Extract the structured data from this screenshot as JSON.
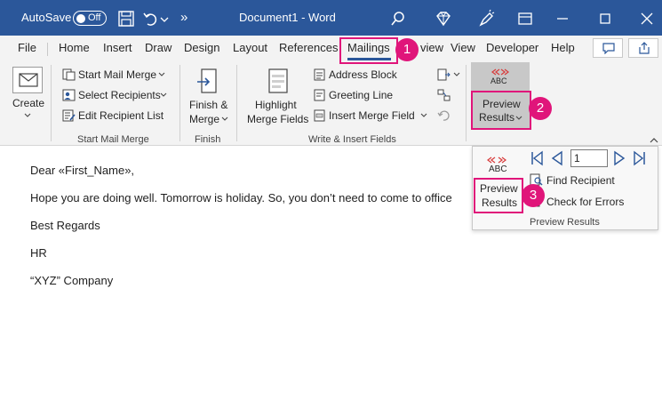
{
  "titlebar": {
    "autosave_label": "AutoSave",
    "autosave_state": "Off",
    "document_title": "Document1  -  Word",
    "more_glyph": "»",
    "bg_color": "#2b579a"
  },
  "tabs": [
    "File",
    "Home",
    "Insert",
    "Draw",
    "Design",
    "Layout",
    "References",
    "Mailings",
    "view",
    "View",
    "Developer",
    "Help"
  ],
  "active_tab": "Mailings",
  "ribbon": {
    "create": {
      "label": "Create",
      "icon": "envelope-icon"
    },
    "start_mail_merge": {
      "items": [
        "Start Mail Merge",
        "Select Recipients",
        "Edit Recipient List"
      ],
      "group_label": "Start Mail Merge"
    },
    "finish": {
      "line1": "Finish &",
      "line2": "Merge",
      "group_label": "Finish"
    },
    "write_insert": {
      "highlight_line1": "Highlight",
      "highlight_line2": "Merge Fields",
      "items": [
        "Address Block",
        "Greeting Line",
        "Insert Merge Field"
      ],
      "group_label": "Write & Insert Fields"
    },
    "preview": {
      "abc": "ABC",
      "line1": "Preview",
      "line2": "Results"
    }
  },
  "badges": [
    "1",
    "2",
    "3"
  ],
  "document": {
    "lines": [
      "Dear «First_Name»,",
      "Hope you are doing well. Tomorrow is holiday. So, you don’t need to come to office",
      "Best Regards",
      "HR",
      "“XYZ” Company"
    ]
  },
  "popup": {
    "abc": "ABC",
    "preview_line1": "Preview",
    "preview_line2": "Results",
    "record_value": "1",
    "find_recipient": "Find Recipient",
    "check_errors": "Check for Errors",
    "group_label": "Preview Results"
  },
  "colors": {
    "accent": "#2b579a",
    "highlight": "#e0157a",
    "nav_blue": "#2b579a",
    "abc_red": "#d83b3b"
  }
}
